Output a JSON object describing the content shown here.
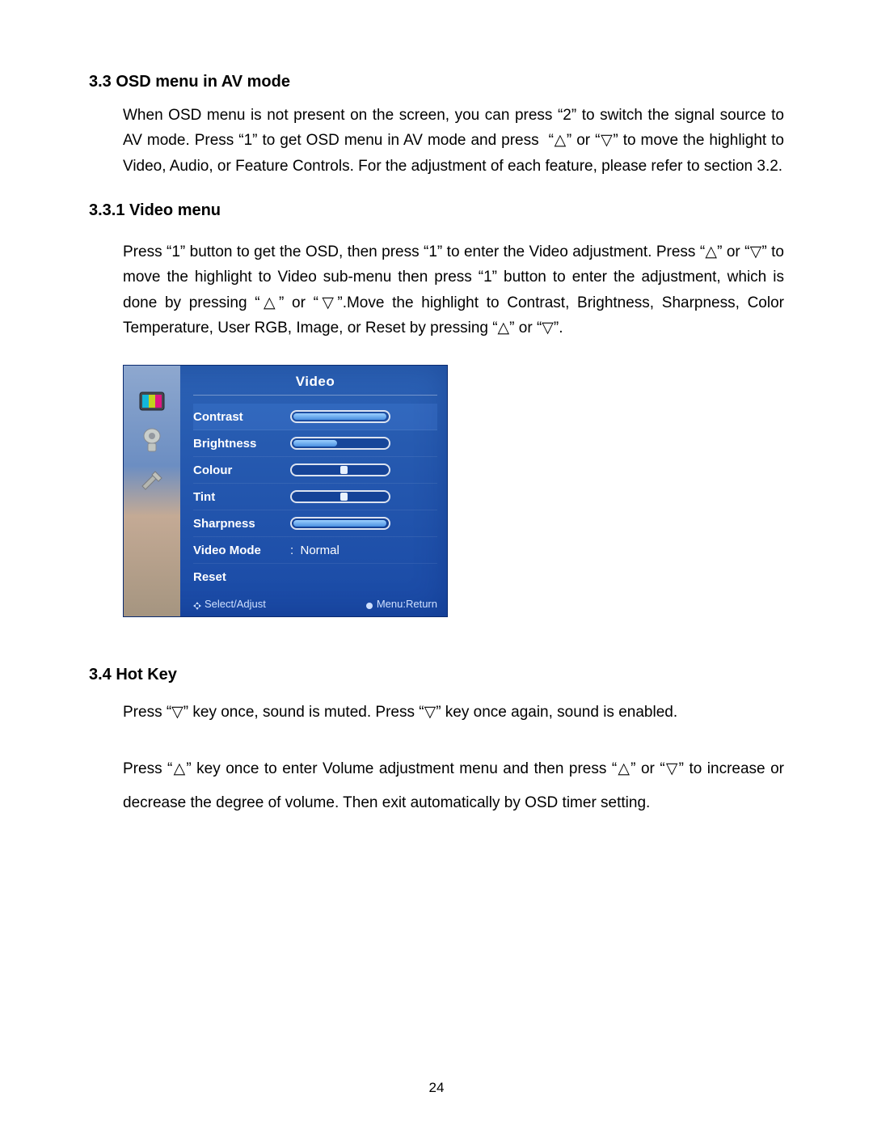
{
  "section33": {
    "heading": "3.3 OSD menu in AV mode",
    "body": "When OSD menu is not present on the screen, you can press “2” to switch the signal source to AV mode. Press “1” to get OSD menu in AV mode and press  “△” or “▽” to move the highlight to Video, Audio, or Feature Controls. For the adjustment of each feature, please refer to section 3.2."
  },
  "section331": {
    "heading": "3.3.1 Video menu",
    "body": "Press “1” button to get the OSD, then press “1” to enter the Video adjustment. Press “△” or “▽” to move the highlight to Video sub-menu then press “1” button to enter the adjustment, which is done by pressing “△” or “▽”.Move the highlight to Contrast, Brightness, Sharpness, Color Temperature, User RGB, Image, or Reset by pressing “△” or “▽”."
  },
  "osd": {
    "title": "Video",
    "tabs": [
      "video-tab-icon",
      "audio-tab-icon",
      "tools-tab-icon"
    ],
    "rows": [
      {
        "label": "Contrast",
        "type": "slider",
        "value": 98
      },
      {
        "label": "Brightness",
        "type": "slider",
        "value": 45
      },
      {
        "label": "Colour",
        "type": "slider",
        "value": 50,
        "knob": true
      },
      {
        "label": "Tint",
        "type": "slider",
        "value": 50,
        "knob": true
      },
      {
        "label": "Sharpness",
        "type": "slider",
        "value": 98
      },
      {
        "label": "Video Mode",
        "type": "value",
        "text": ":  Normal"
      },
      {
        "label": "Reset",
        "type": "none"
      }
    ],
    "footer": {
      "left": "Select/Adjust",
      "right": "Menu:Return"
    }
  },
  "section34": {
    "heading": "3.4 Hot Key",
    "p1": "Press “▽” key once, sound is muted. Press “▽” key once again, sound is enabled.",
    "p2": "Press “△” key once to enter Volume adjustment menu and then press “△” or “▽” to increase or decrease the degree of volume. Then exit automatically by OSD timer setting."
  },
  "pageNumber": "24"
}
